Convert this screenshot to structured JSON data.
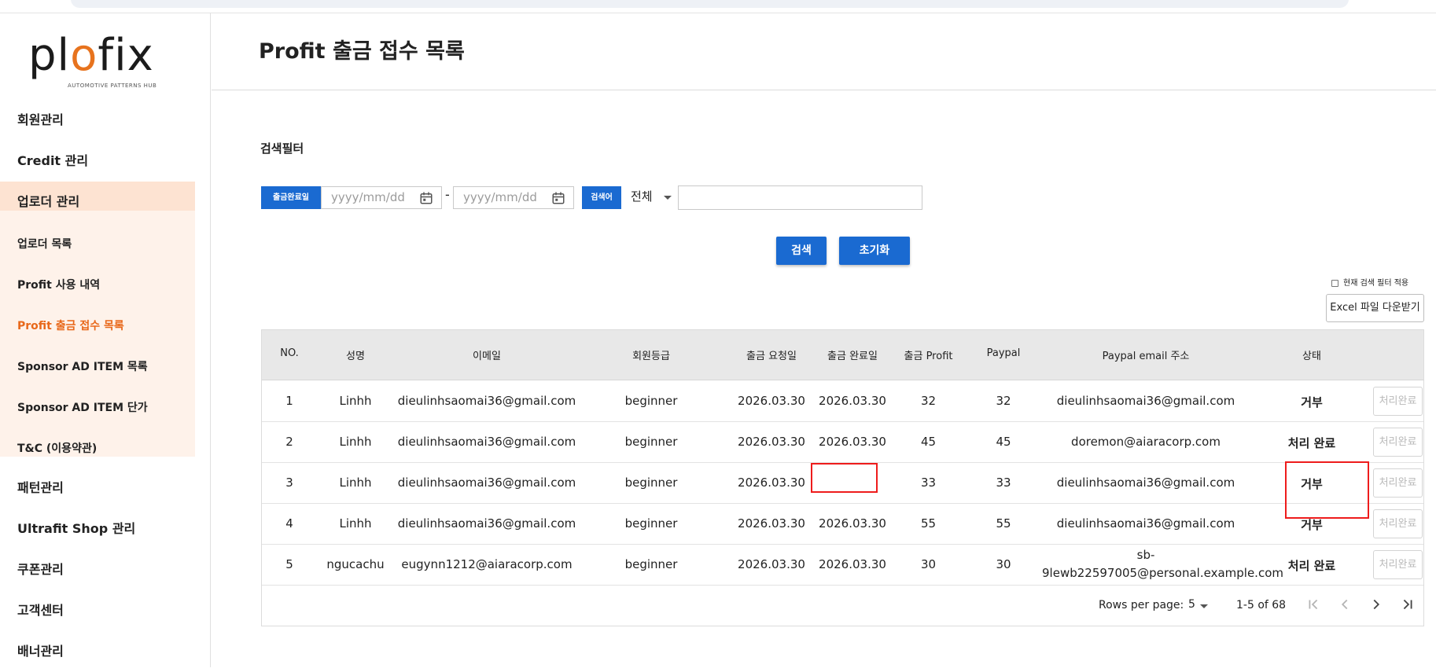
{
  "logo": {
    "brand_prefix": "pl",
    "brand_accent": "o",
    "brand_suffix": "fix",
    "tagline": "AUTOMOTIVE PATTERNS HUB"
  },
  "sidebar": {
    "items": [
      {
        "label": "회원관리"
      },
      {
        "label": "Credit 관리"
      },
      {
        "label": "업로더 관리"
      }
    ],
    "sub_items": [
      {
        "label": "업로더 목록"
      },
      {
        "label": "Profit 사용 내역"
      },
      {
        "label": "Profit 출금 접수 목록"
      },
      {
        "label": "Sponsor AD ITEM 목록"
      },
      {
        "label": "Sponsor AD ITEM 단가"
      },
      {
        "label": "T&C (이용약관)"
      }
    ],
    "bottom_items": [
      {
        "label": "패턴관리"
      },
      {
        "label": "Ultrafit Shop 관리"
      },
      {
        "label": "쿠폰관리"
      },
      {
        "label": "고객센터"
      },
      {
        "label": "배너관리"
      }
    ]
  },
  "header": {
    "title": "Profit 출금 접수 목록"
  },
  "filter": {
    "title": "검색필터",
    "date_chip": "출금완료일",
    "date_from_placeholder": "yyyy/mm/dd",
    "date_to_placeholder": "yyyy/mm/dd",
    "dash": "-",
    "keyword_chip": "검색어",
    "select_value": "전체",
    "search_value": "",
    "search_button": "검색",
    "reset_button": "초기화"
  },
  "toolbar": {
    "apply_filter_label": "현재 검색 필터 적용",
    "excel_button": "Excel 파일 다운받기"
  },
  "table": {
    "columns": [
      "NO.",
      "성명",
      "이메일",
      "회원등급",
      "출금 요청일",
      "출금 완료일",
      "출금 Profit",
      "Paypal",
      "Paypal email 주소",
      "상태"
    ],
    "rows": [
      {
        "no": "1",
        "name": "Linhh",
        "email": "dieulinhsaomai36@gmail.com",
        "grade": "beginner",
        "requested": "2026.03.30",
        "completed": "2026.03.30",
        "profit": "32",
        "paypal": "32",
        "paypal_email": "dieulinhsaomai36@gmail.com",
        "paypal_email_2": "",
        "status": "거부",
        "action": "처리완료"
      },
      {
        "no": "2",
        "name": "Linhh",
        "email": "dieulinhsaomai36@gmail.com",
        "grade": "beginner",
        "requested": "2026.03.30",
        "completed": "2026.03.30",
        "profit": "45",
        "paypal": "45",
        "paypal_email": "doremon@aiaracorp.com",
        "paypal_email_2": "",
        "status": "처리 완료",
        "action": "처리완료"
      },
      {
        "no": "3",
        "name": "Linhh",
        "email": "dieulinhsaomai36@gmail.com",
        "grade": "beginner",
        "requested": "2026.03.30",
        "completed": "",
        "profit": "33",
        "paypal": "33",
        "paypal_email": "dieulinhsaomai36@gmail.com",
        "paypal_email_2": "",
        "status": "거부",
        "action": "처리완료"
      },
      {
        "no": "4",
        "name": "Linhh",
        "email": "dieulinhsaomai36@gmail.com",
        "grade": "beginner",
        "requested": "2026.03.30",
        "completed": "2026.03.30",
        "profit": "55",
        "paypal": "55",
        "paypal_email": "dieulinhsaomai36@gmail.com",
        "paypal_email_2": "",
        "status": "거부",
        "action": "처리완료"
      },
      {
        "no": "5",
        "name": "ngucachu",
        "email": "eugynn1212@aiaracorp.com",
        "grade": "beginner",
        "requested": "2026.03.30",
        "completed": "2026.03.30",
        "profit": "30",
        "paypal": "30",
        "paypal_email": "sb-",
        "paypal_email_2": "9lewb22597005@personal.example.com",
        "status": "처리 완료",
        "action": "처리완료"
      }
    ]
  },
  "pagination": {
    "rows_per_page_label": "Rows per page:",
    "rows_per_page_value": "5",
    "range": "1-5 of 68"
  },
  "colors": {
    "accent": "#1a6ad1",
    "brand_orange": "#e8681a",
    "highlight": "#ee1c1c"
  }
}
